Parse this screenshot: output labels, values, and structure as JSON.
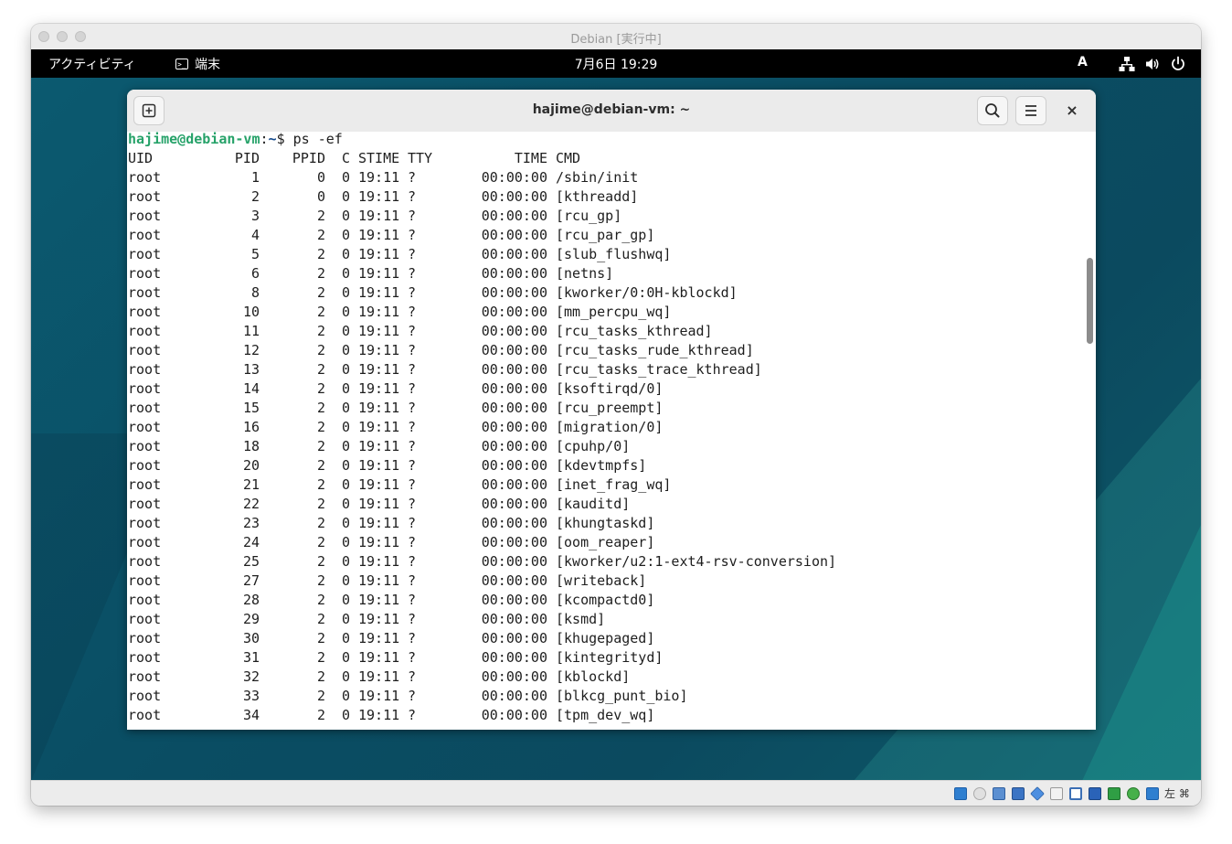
{
  "vm_window": {
    "title": "Debian [実行中]",
    "host_key_label": "左 ⌘"
  },
  "topbar": {
    "activities": "アクティビティ",
    "app_name": "端末",
    "clock": "7月6日 19:29",
    "input_method": "A",
    "tray_icons": [
      "network-icon",
      "volume-icon",
      "power-icon"
    ]
  },
  "terminal": {
    "title": "hajime@debian-vm: ~",
    "new_tab_icon": "new-tab-icon",
    "search_icon": "search-icon",
    "menu_icon": "hamburger-menu-icon",
    "close_label": "×",
    "prompt_user": "hajime@debian-vm",
    "prompt_sep": ":",
    "prompt_path": "~",
    "prompt_symbol": "$ ",
    "command": "ps -ef",
    "columns": [
      "UID",
      "PID",
      "PPID",
      "C",
      "STIME",
      "TTY",
      "TIME",
      "CMD"
    ],
    "rows": [
      [
        "root",
        "1",
        "0",
        "0",
        "19:11",
        "?",
        "00:00:00",
        "/sbin/init"
      ],
      [
        "root",
        "2",
        "0",
        "0",
        "19:11",
        "?",
        "00:00:00",
        "[kthreadd]"
      ],
      [
        "root",
        "3",
        "2",
        "0",
        "19:11",
        "?",
        "00:00:00",
        "[rcu_gp]"
      ],
      [
        "root",
        "4",
        "2",
        "0",
        "19:11",
        "?",
        "00:00:00",
        "[rcu_par_gp]"
      ],
      [
        "root",
        "5",
        "2",
        "0",
        "19:11",
        "?",
        "00:00:00",
        "[slub_flushwq]"
      ],
      [
        "root",
        "6",
        "2",
        "0",
        "19:11",
        "?",
        "00:00:00",
        "[netns]"
      ],
      [
        "root",
        "8",
        "2",
        "0",
        "19:11",
        "?",
        "00:00:00",
        "[kworker/0:0H-kblockd]"
      ],
      [
        "root",
        "10",
        "2",
        "0",
        "19:11",
        "?",
        "00:00:00",
        "[mm_percpu_wq]"
      ],
      [
        "root",
        "11",
        "2",
        "0",
        "19:11",
        "?",
        "00:00:00",
        "[rcu_tasks_kthread]"
      ],
      [
        "root",
        "12",
        "2",
        "0",
        "19:11",
        "?",
        "00:00:00",
        "[rcu_tasks_rude_kthread]"
      ],
      [
        "root",
        "13",
        "2",
        "0",
        "19:11",
        "?",
        "00:00:00",
        "[rcu_tasks_trace_kthread]"
      ],
      [
        "root",
        "14",
        "2",
        "0",
        "19:11",
        "?",
        "00:00:00",
        "[ksoftirqd/0]"
      ],
      [
        "root",
        "15",
        "2",
        "0",
        "19:11",
        "?",
        "00:00:00",
        "[rcu_preempt]"
      ],
      [
        "root",
        "16",
        "2",
        "0",
        "19:11",
        "?",
        "00:00:00",
        "[migration/0]"
      ],
      [
        "root",
        "18",
        "2",
        "0",
        "19:11",
        "?",
        "00:00:00",
        "[cpuhp/0]"
      ],
      [
        "root",
        "20",
        "2",
        "0",
        "19:11",
        "?",
        "00:00:00",
        "[kdevtmpfs]"
      ],
      [
        "root",
        "21",
        "2",
        "0",
        "19:11",
        "?",
        "00:00:00",
        "[inet_frag_wq]"
      ],
      [
        "root",
        "22",
        "2",
        "0",
        "19:11",
        "?",
        "00:00:00",
        "[kauditd]"
      ],
      [
        "root",
        "23",
        "2",
        "0",
        "19:11",
        "?",
        "00:00:00",
        "[khungtaskd]"
      ],
      [
        "root",
        "24",
        "2",
        "0",
        "19:11",
        "?",
        "00:00:00",
        "[oom_reaper]"
      ],
      [
        "root",
        "25",
        "2",
        "0",
        "19:11",
        "?",
        "00:00:00",
        "[kworker/u2:1-ext4-rsv-conversion]"
      ],
      [
        "root",
        "27",
        "2",
        "0",
        "19:11",
        "?",
        "00:00:00",
        "[writeback]"
      ],
      [
        "root",
        "28",
        "2",
        "0",
        "19:11",
        "?",
        "00:00:00",
        "[kcompactd0]"
      ],
      [
        "root",
        "29",
        "2",
        "0",
        "19:11",
        "?",
        "00:00:00",
        "[ksmd]"
      ],
      [
        "root",
        "30",
        "2",
        "0",
        "19:11",
        "?",
        "00:00:00",
        "[khugepaged]"
      ],
      [
        "root",
        "31",
        "2",
        "0",
        "19:11",
        "?",
        "00:00:00",
        "[kintegrityd]"
      ],
      [
        "root",
        "32",
        "2",
        "0",
        "19:11",
        "?",
        "00:00:00",
        "[kblockd]"
      ],
      [
        "root",
        "33",
        "2",
        "0",
        "19:11",
        "?",
        "00:00:00",
        "[blkcg_punt_bio]"
      ],
      [
        "root",
        "34",
        "2",
        "0",
        "19:11",
        "?",
        "00:00:00",
        "[tpm_dev_wq]"
      ]
    ]
  },
  "colors": {
    "prompt_user": "#26a269",
    "prompt_path": "#12488b",
    "desktop": "#0b5a70"
  },
  "statusbar": {
    "icons": [
      "hard-disk-icon",
      "optical-drive-icon",
      "audio-icon",
      "network-adapter-icon",
      "usb-icon",
      "shared-folder-icon",
      "display-icon",
      "video-capture-icon",
      "cpu-icon",
      "guest-additions-icon",
      "download-icon"
    ]
  }
}
